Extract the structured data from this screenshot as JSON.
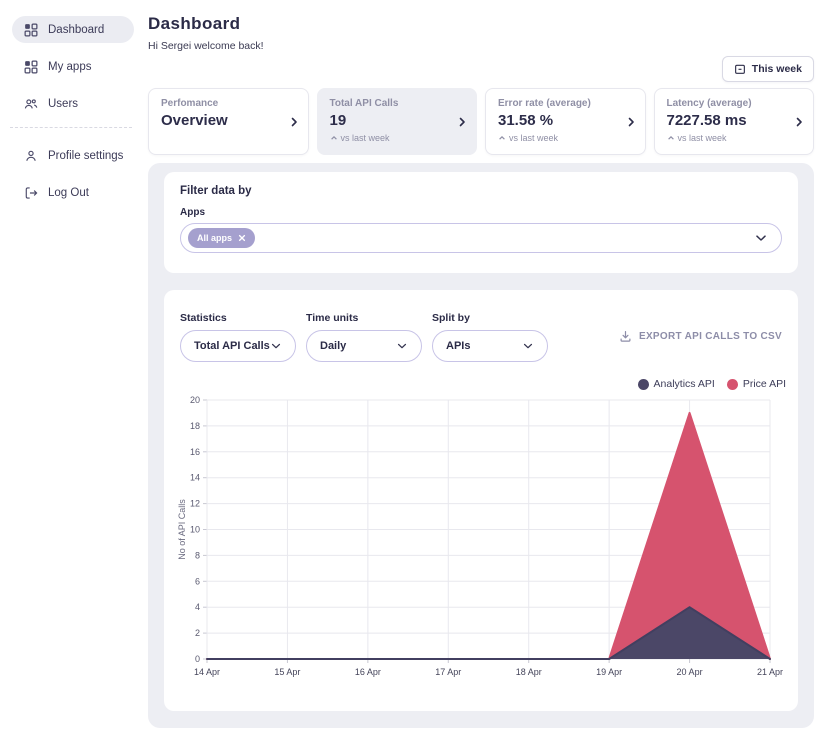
{
  "sidebar": {
    "items": [
      {
        "label": "Dashboard",
        "icon": "grid-icon",
        "active": true
      },
      {
        "label": "My apps",
        "icon": "grid-icon",
        "active": false
      },
      {
        "label": "Users",
        "icon": "users-icon",
        "active": false
      },
      {
        "label": "Profile settings",
        "icon": "person-icon",
        "active": false
      },
      {
        "label": "Log Out",
        "icon": "logout-icon",
        "active": false
      }
    ]
  },
  "header": {
    "title": "Dashboard",
    "greeting": "Hi Sergei welcome back!",
    "range_label": "This week"
  },
  "cards": [
    {
      "label": "Perfomance",
      "value": "Overview"
    },
    {
      "label": "Total API Calls",
      "value": "19",
      "sub": "vs last week"
    },
    {
      "label": "Error rate (average)",
      "value": "31.58 %",
      "sub": "vs last week"
    },
    {
      "label": "Latency (average)",
      "value": "7227.58 ms",
      "sub": "vs last week"
    }
  ],
  "filter": {
    "heading": "Filter data by",
    "field_label": "Apps",
    "chip_label": "All apps"
  },
  "stats": {
    "controls": [
      {
        "label": "Statistics",
        "value": "Total API Calls"
      },
      {
        "label": "Time units",
        "value": "Daily"
      },
      {
        "label": "Split by",
        "value": "APIs"
      }
    ],
    "export_label": "EXPORT API CALLS TO CSV"
  },
  "colors": {
    "panel_bg": "#edeef3",
    "chip_bg": "#a5a0ce",
    "pill_border": "#c8c4e7",
    "grid_line": "#e8e8ee",
    "tick_line": "#c8c8d2",
    "analytics": "#4b4767",
    "price": "#d6536e"
  },
  "chart_data": {
    "type": "area",
    "stacked": true,
    "x": [
      "14 Apr",
      "15 Apr",
      "16 Apr",
      "17 Apr",
      "18 Apr",
      "19 Apr",
      "20 Apr",
      "21 Apr"
    ],
    "series": [
      {
        "name": "Analytics API",
        "color": "#4b4767",
        "stroke": "#423f60",
        "values": [
          0,
          0,
          0,
          0,
          0,
          0,
          4,
          0
        ]
      },
      {
        "name": "Price API",
        "color": "#d6536e",
        "stroke": "#d6536e",
        "values": [
          0,
          0,
          0,
          0,
          0,
          0,
          15,
          0
        ]
      }
    ],
    "title": "",
    "xlabel": "",
    "ylabel": "No of API Calls",
    "ylim": [
      0,
      20
    ],
    "ytick_step": 2,
    "grid": true,
    "legend_position": "top-right"
  }
}
